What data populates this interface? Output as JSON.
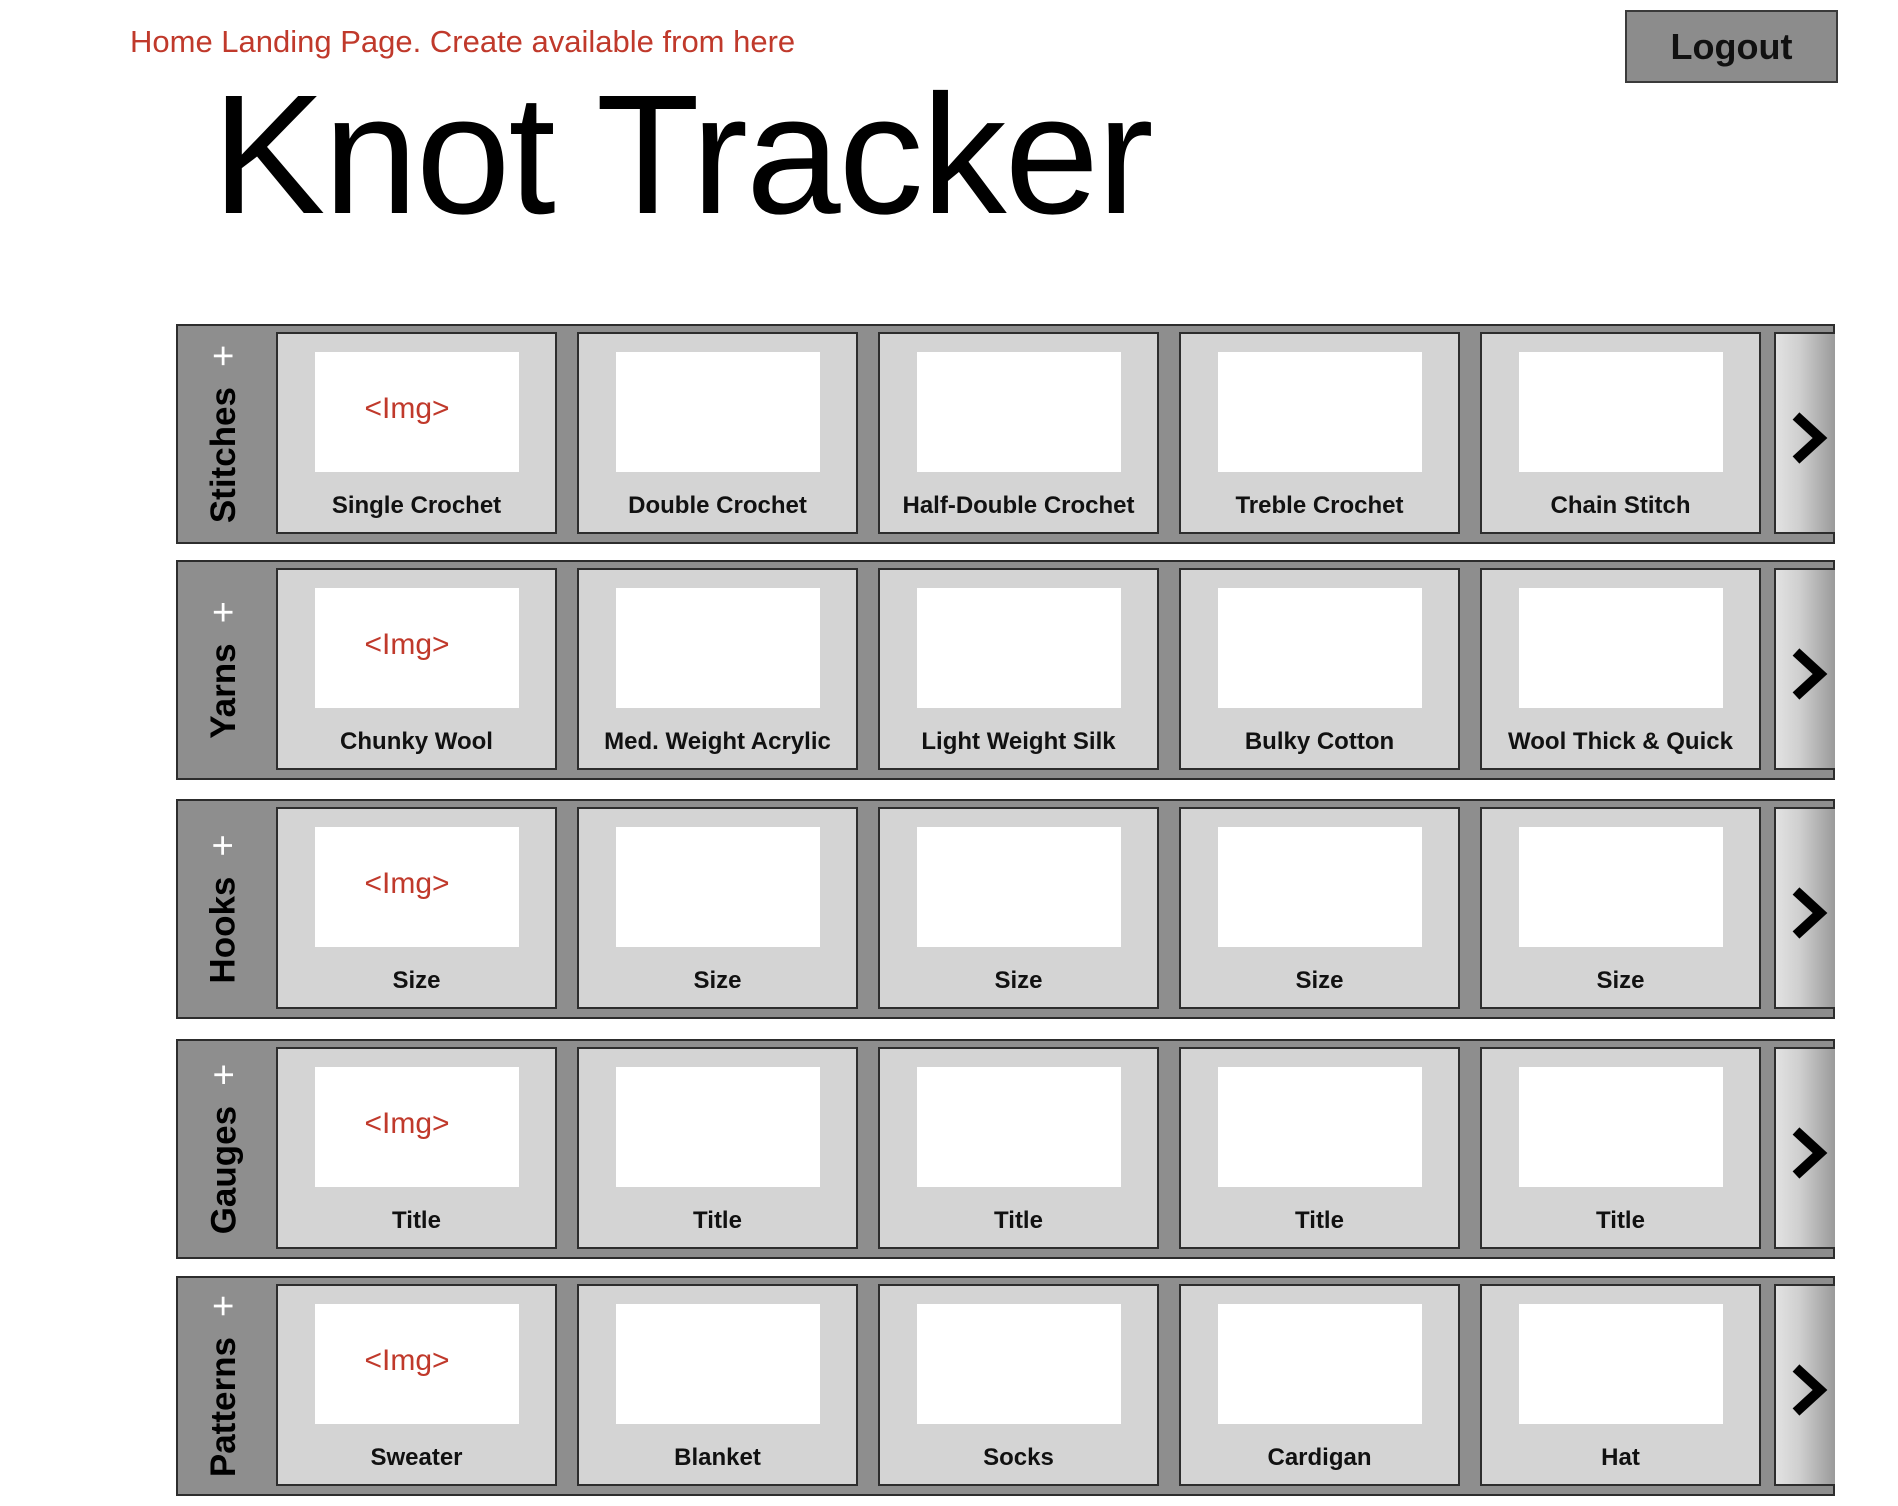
{
  "header": {
    "note": "Home Landing Page. Create available from here",
    "logout_label": "Logout",
    "title": "Knot Tracker"
  },
  "colors": {
    "annotation": "#c0392b",
    "shelf_bg": "#8e8e8e",
    "card_bg": "#d4d4d4"
  },
  "sections": [
    {
      "title": "Stitches",
      "add_icon": "+",
      "cards": [
        {
          "image": "<Img>",
          "label": "Single Crochet"
        },
        {
          "image": "",
          "label": "Double Crochet"
        },
        {
          "image": "",
          "label": "Half-Double Crochet"
        },
        {
          "image": "",
          "label": "Treble Crochet"
        },
        {
          "image": "",
          "label": "Chain Stitch"
        }
      ]
    },
    {
      "title": "Yarns",
      "add_icon": "+",
      "cards": [
        {
          "image": "<Img>",
          "label": "Chunky Wool"
        },
        {
          "image": "",
          "label": "Med. Weight Acrylic"
        },
        {
          "image": "",
          "label": "Light Weight Silk"
        },
        {
          "image": "",
          "label": "Bulky Cotton"
        },
        {
          "image": "",
          "label": "Wool Thick & Quick"
        }
      ]
    },
    {
      "title": "Hooks",
      "add_icon": "+",
      "cards": [
        {
          "image": "<Img>",
          "label": "Size"
        },
        {
          "image": "",
          "label": "Size"
        },
        {
          "image": "",
          "label": "Size"
        },
        {
          "image": "",
          "label": "Size"
        },
        {
          "image": "",
          "label": "Size"
        }
      ]
    },
    {
      "title": "Gauges",
      "add_icon": "+",
      "cards": [
        {
          "image": "<Img>",
          "label": "Title"
        },
        {
          "image": "",
          "label": "Title"
        },
        {
          "image": "",
          "label": "Title"
        },
        {
          "image": "",
          "label": "Title"
        },
        {
          "image": "",
          "label": "Title"
        }
      ]
    },
    {
      "title": "Patterns",
      "add_icon": "+",
      "cards": [
        {
          "image": "<Img>",
          "label": "Sweater"
        },
        {
          "image": "",
          "label": "Blanket"
        },
        {
          "image": "",
          "label": "Socks"
        },
        {
          "image": "",
          "label": "Cardigan"
        },
        {
          "image": "",
          "label": "Hat"
        }
      ]
    }
  ]
}
